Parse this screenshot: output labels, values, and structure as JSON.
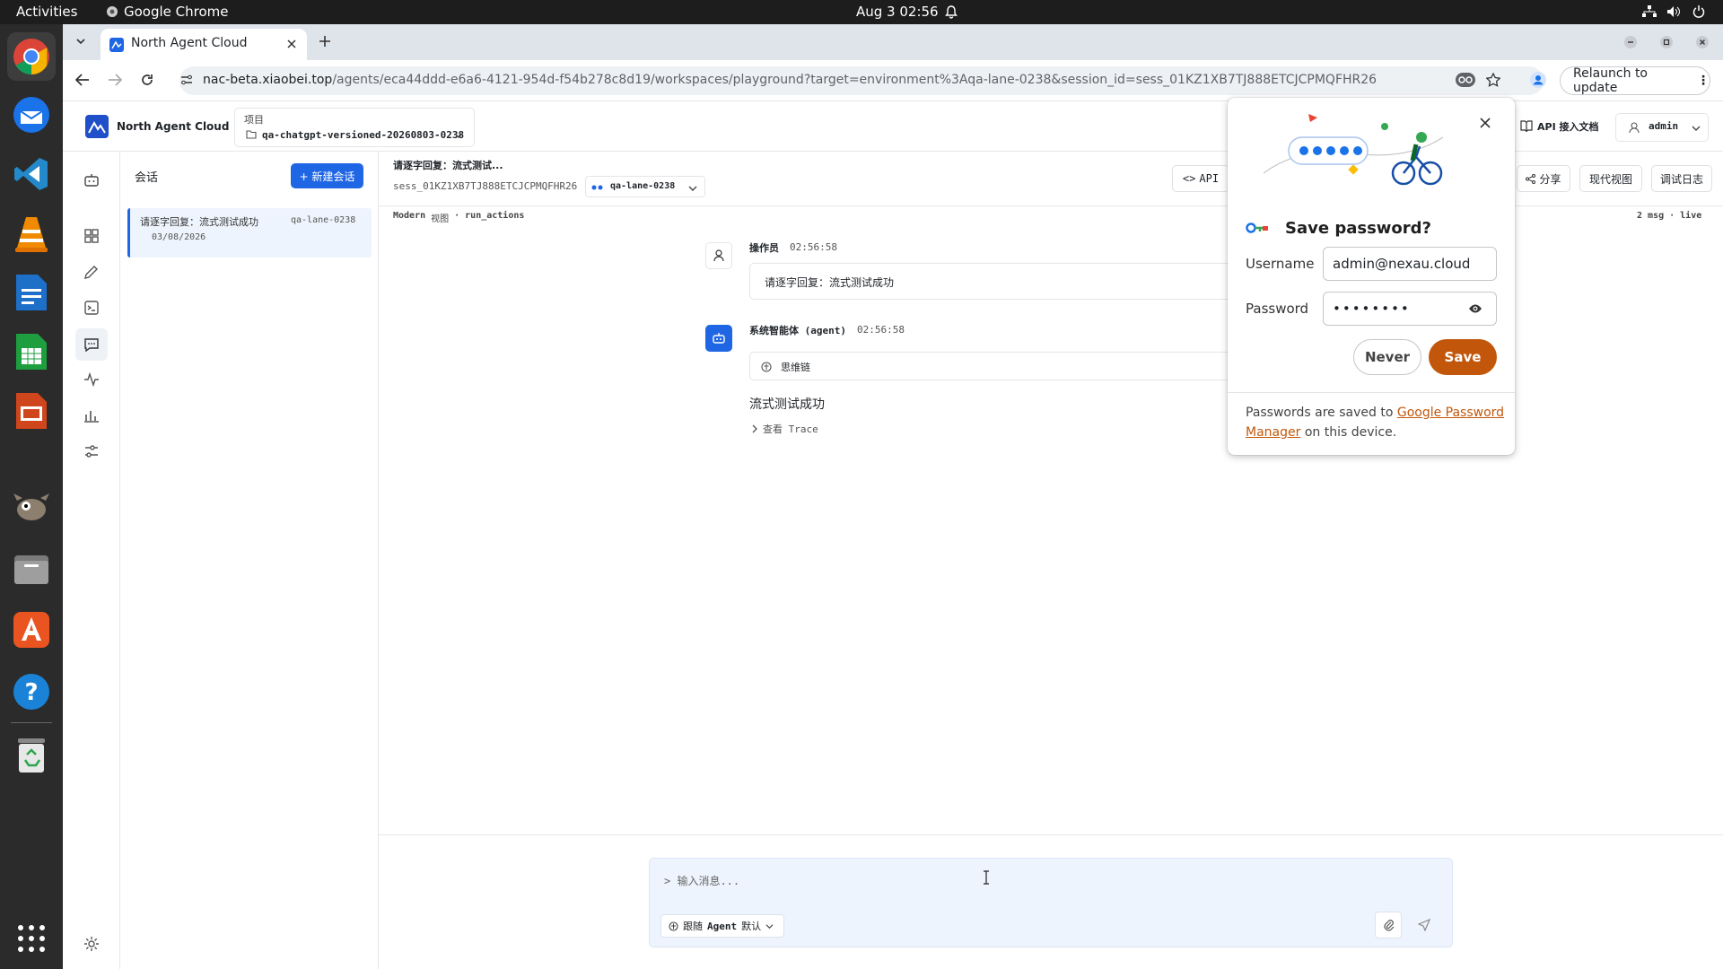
{
  "topbar": {
    "activities": "Activities",
    "app": "Google Chrome",
    "datetime": "Aug 3  02:56"
  },
  "browser": {
    "tab_title": "North Agent Cloud",
    "url_host": "nac-beta.xiaobei.top",
    "url_path": "/agents/eca44ddd-e6a6-4121-954d-f54b278c8d19/workspaces/playground?target=environment%3Aqa-lane-0238&session_id=sess_01KZ1XB7TJ888ETCJCPMQFHR26",
    "relaunch": "Relaunch to update"
  },
  "header": {
    "logo_text": "North Agent Cloud",
    "project_label": "项目",
    "project_value": "qa-chatgpt-versioned-20260803-0238",
    "api_docs": "API 接入文档",
    "user": "admin"
  },
  "sessions": {
    "title": "会话",
    "new_button": "+ 新建会话",
    "items": [
      {
        "title": "请逐字回复：流式测试成功",
        "tag": "qa-lane-0238",
        "date": "03/08/2026"
      }
    ]
  },
  "main": {
    "session_title": "请逐字回复：流式测试...",
    "session_id": "sess_01KZ1XB7TJ888ETCJCPMQFHR26",
    "env": "qa-lane-0238",
    "api_btn": "API",
    "share_btn": "分享",
    "modern_view_btn": "现代视图",
    "debug_log_btn": "调试日志",
    "subbar_left_1": "Modern",
    "subbar_left_2": "视图",
    "subbar_left_3": "· run_actions",
    "subbar_right": "2 msg · live"
  },
  "messages": [
    {
      "role": "操作员",
      "time": "02:56:58",
      "text": "请逐字回复：流式测试成功"
    },
    {
      "role": "系统智能体 (agent)",
      "time": "02:56:58",
      "thinking": "思维链",
      "text": "流式测试成功",
      "trace": "查看 Trace"
    }
  ],
  "composer": {
    "placeholder": "> 输入消息...",
    "mode_1": "跟随",
    "mode_2": "Agent",
    "mode_3": "默认"
  },
  "popup": {
    "title": "Save password?",
    "username_label": "Username",
    "username_value": "admin@nexau.cloud",
    "password_label": "Password",
    "password_value": "••••••••",
    "never": "Never",
    "save": "Save",
    "footer_1": "Passwords are saved to",
    "footer_link": "Google Password Manager",
    "footer_2": "on this device."
  }
}
